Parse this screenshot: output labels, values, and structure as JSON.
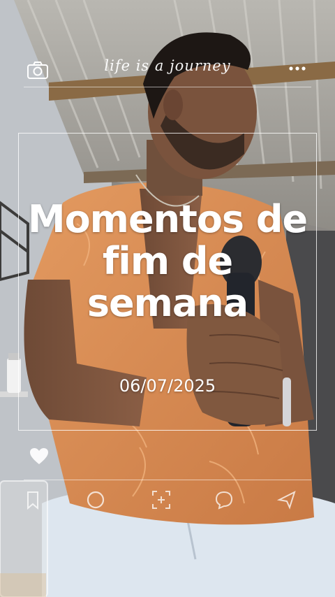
{
  "header": {
    "tagline": "life is a journey",
    "left_icon": "camera-icon",
    "right_icon": "more-icon"
  },
  "card": {
    "title": "Momentos de fim de semana",
    "date": "06/07/2025"
  },
  "side_icons": [
    "heart-icon"
  ],
  "bottom_bar": {
    "icons": [
      "bookmark-icon",
      "circle-icon",
      "focus-add-icon",
      "comment-icon",
      "send-icon"
    ]
  },
  "colors": {
    "overlay_text": "#ffffff",
    "shirt": "#d98a4f",
    "jeans": "#dde6ef",
    "roof": "#aaa7a0"
  }
}
